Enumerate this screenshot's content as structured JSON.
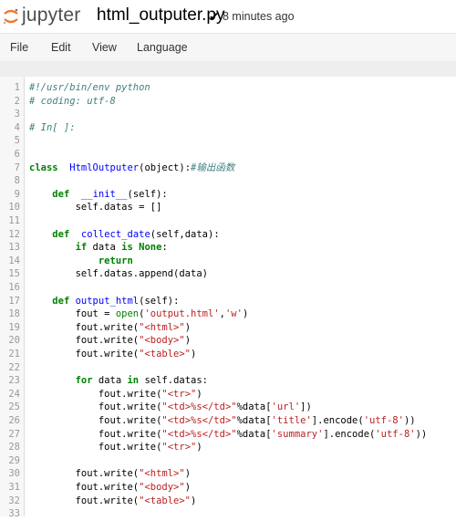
{
  "header": {
    "logo_text": "jupyter",
    "notebook_name": "html_outputer.py",
    "saved_status": "8 minutes ago"
  },
  "menu": [
    "File",
    "Edit",
    "View",
    "Language"
  ],
  "code_lines": [
    {
      "n": "1",
      "parts": [
        [
          "cm",
          "#!/usr/bin/env python"
        ]
      ]
    },
    {
      "n": "2",
      "parts": [
        [
          "cm",
          "# coding: utf-8"
        ]
      ]
    },
    {
      "n": "3",
      "parts": []
    },
    {
      "n": "4",
      "parts": [
        [
          "cm",
          "# In[ ]:"
        ]
      ]
    },
    {
      "n": "5",
      "parts": []
    },
    {
      "n": "6",
      "parts": []
    },
    {
      "n": "7",
      "parts": [
        [
          "kw",
          "class"
        ],
        [
          "",
          "  "
        ],
        [
          "def",
          "HtmlOutputer"
        ],
        [
          "",
          "(object):"
        ],
        [
          "cm",
          "#输出函数"
        ]
      ]
    },
    {
      "n": "8",
      "parts": []
    },
    {
      "n": "9",
      "parts": [
        [
          "",
          "    "
        ],
        [
          "kw",
          "def"
        ],
        [
          "",
          "  "
        ],
        [
          "def",
          "__init__"
        ],
        [
          "",
          "(self):"
        ]
      ]
    },
    {
      "n": "10",
      "parts": [
        [
          "",
          "        self.datas = []"
        ]
      ]
    },
    {
      "n": "11",
      "parts": []
    },
    {
      "n": "12",
      "parts": [
        [
          "",
          "    "
        ],
        [
          "kw",
          "def"
        ],
        [
          "",
          "  "
        ],
        [
          "def",
          "collect_date"
        ],
        [
          "",
          "(self,data):"
        ]
      ]
    },
    {
      "n": "13",
      "parts": [
        [
          "",
          "        "
        ],
        [
          "kw",
          "if"
        ],
        [
          "",
          " data "
        ],
        [
          "kw",
          "is"
        ],
        [
          "",
          ""
        ],
        [
          "kw",
          " None"
        ],
        [
          "",
          ":"
        ]
      ]
    },
    {
      "n": "14",
      "parts": [
        [
          "",
          "            "
        ],
        [
          "kw",
          "return"
        ]
      ]
    },
    {
      "n": "15",
      "parts": [
        [
          "",
          "        self.datas.append(data)"
        ]
      ]
    },
    {
      "n": "16",
      "parts": []
    },
    {
      "n": "17",
      "parts": [
        [
          "",
          "    "
        ],
        [
          "kw",
          "def"
        ],
        [
          "",
          " "
        ],
        [
          "def",
          "output_html"
        ],
        [
          "",
          "(self):"
        ]
      ]
    },
    {
      "n": "18",
      "parts": [
        [
          "",
          "        fout = "
        ],
        [
          "bi",
          "open"
        ],
        [
          "",
          "("
        ],
        [
          "st",
          "'output.html'"
        ],
        [
          "",
          ","
        ],
        [
          "st",
          "'w'"
        ],
        [
          "",
          ")"
        ]
      ]
    },
    {
      "n": "19",
      "parts": [
        [
          "",
          "        fout.write("
        ],
        [
          "st",
          "\"<html>\""
        ],
        [
          "",
          ")"
        ]
      ]
    },
    {
      "n": "20",
      "parts": [
        [
          "",
          "        fout.write("
        ],
        [
          "st",
          "\"<body>\""
        ],
        [
          "",
          ")"
        ]
      ]
    },
    {
      "n": "21",
      "parts": [
        [
          "",
          "        fout.write("
        ],
        [
          "st",
          "\"<table>\""
        ],
        [
          "",
          ")"
        ]
      ]
    },
    {
      "n": "22",
      "parts": []
    },
    {
      "n": "23",
      "parts": [
        [
          "",
          "        "
        ],
        [
          "kw",
          "for"
        ],
        [
          "",
          " data "
        ],
        [
          "kw",
          "in"
        ],
        [
          "",
          " self.datas:"
        ]
      ]
    },
    {
      "n": "24",
      "parts": [
        [
          "",
          "            fout.write("
        ],
        [
          "st",
          "\"<tr>\""
        ],
        [
          "",
          ")"
        ]
      ]
    },
    {
      "n": "25",
      "parts": [
        [
          "",
          "            fout.write("
        ],
        [
          "st",
          "\"<td>%s</td>\""
        ],
        [
          "",
          "%data["
        ],
        [
          "st",
          "'url'"
        ],
        [
          "",
          "])"
        ]
      ]
    },
    {
      "n": "26",
      "parts": [
        [
          "",
          "            fout.write("
        ],
        [
          "st",
          "\"<td>%s</td>\""
        ],
        [
          "",
          "%data["
        ],
        [
          "st",
          "'title'"
        ],
        [
          "",
          "].encode("
        ],
        [
          "st",
          "'utf-8'"
        ],
        [
          "",
          "))"
        ]
      ]
    },
    {
      "n": "27",
      "parts": [
        [
          "",
          "            fout.write("
        ],
        [
          "st",
          "\"<td>%s</td>\""
        ],
        [
          "",
          "%data["
        ],
        [
          "st",
          "'summary'"
        ],
        [
          "",
          "].encode("
        ],
        [
          "st",
          "'utf-8'"
        ],
        [
          "",
          "))"
        ]
      ]
    },
    {
      "n": "28",
      "parts": [
        [
          "",
          "            fout.write("
        ],
        [
          "st",
          "\"<tr>\""
        ],
        [
          "",
          ")"
        ]
      ]
    },
    {
      "n": "29",
      "parts": []
    },
    {
      "n": "30",
      "parts": [
        [
          "",
          "        fout.write("
        ],
        [
          "st",
          "\"<html>\""
        ],
        [
          "",
          ")"
        ]
      ]
    },
    {
      "n": "31",
      "parts": [
        [
          "",
          "        fout.write("
        ],
        [
          "st",
          "\"<body>\""
        ],
        [
          "",
          ")"
        ]
      ]
    },
    {
      "n": "32",
      "parts": [
        [
          "",
          "        fout.write("
        ],
        [
          "st",
          "\"<table>\""
        ],
        [
          "",
          ")"
        ]
      ]
    },
    {
      "n": "33",
      "parts": []
    }
  ]
}
